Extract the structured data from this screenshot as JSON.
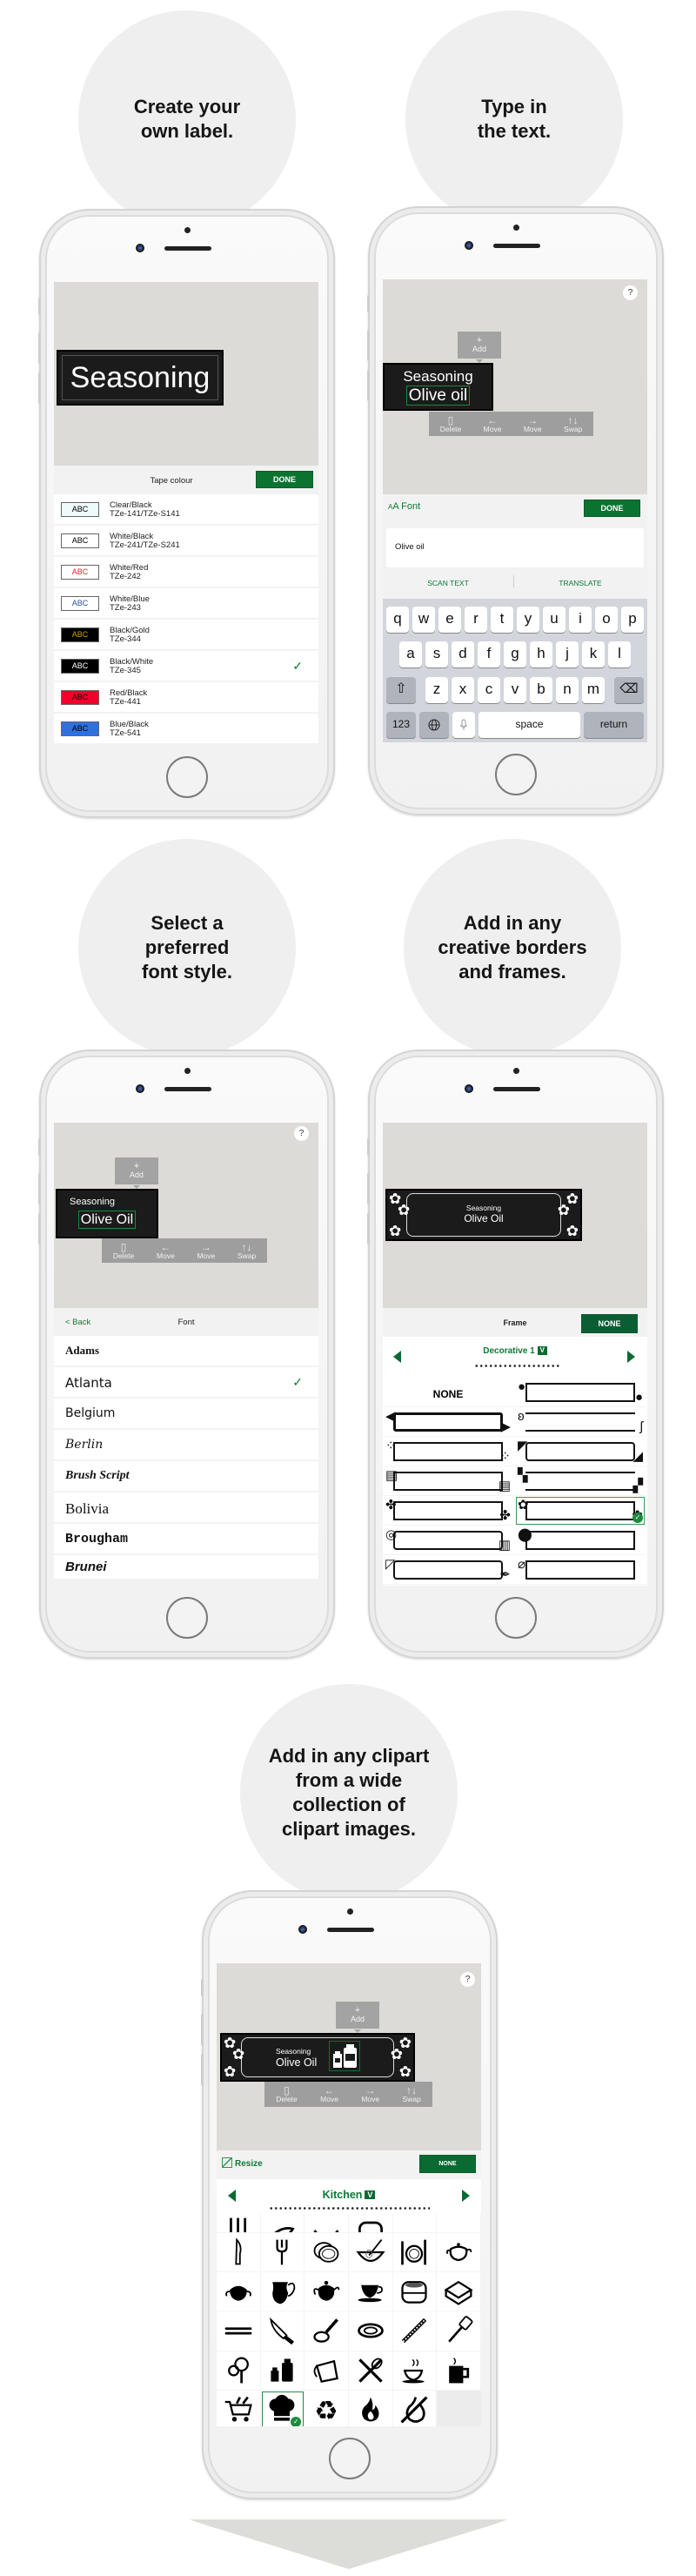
{
  "colors": {
    "accent": "#0b7a33",
    "button": "#0b7330",
    "canvas": "#dcdbd7",
    "circle": "#efefef",
    "arrow": "#dcdcd8"
  },
  "steps": [
    {
      "caption": [
        "Create your",
        "own label."
      ]
    },
    {
      "caption": [
        "Type in",
        "the text."
      ]
    },
    {
      "caption": [
        "Select a",
        "preferred",
        "font style."
      ]
    },
    {
      "caption": [
        "Add in any",
        "creative borders",
        "and frames."
      ]
    },
    {
      "caption": [
        "Add in any clipart",
        "from a wide",
        "collection of",
        "clipart images."
      ]
    }
  ],
  "phone1": {
    "label_text": "Seasoning",
    "toolbar_title": "Tape colour",
    "done": "DONE",
    "selected_index": 5,
    "tapes": [
      {
        "swatch": "ABC",
        "name": "Clear/Black",
        "code": "TZe-141/TZe-S141",
        "bg": "#eefafc",
        "fg": "#000000"
      },
      {
        "swatch": "ABC",
        "name": "White/Black",
        "code": "TZe-241/TZe-S241",
        "bg": "#ffffff",
        "fg": "#000000"
      },
      {
        "swatch": "ABC",
        "name": "White/Red",
        "code": "TZe-242",
        "bg": "#ffffff",
        "fg": "#e8232e"
      },
      {
        "swatch": "ABC",
        "name": "White/Blue",
        "code": "TZe-243",
        "bg": "#ffffff",
        "fg": "#2b4fa8"
      },
      {
        "swatch": "ABC",
        "name": "Black/Gold",
        "code": "TZe-344",
        "bg": "#000000",
        "fg": "#c9a000"
      },
      {
        "swatch": "ABC",
        "name": "Black/White",
        "code": "TZe-345",
        "bg": "#000000",
        "fg": "#ffffff"
      },
      {
        "swatch": "ABC",
        "name": "Red/Black",
        "code": "TZe-441",
        "bg": "#f0002a",
        "fg": "#000000"
      },
      {
        "swatch": "ABC",
        "name": "Blue/Black",
        "code": "TZe-541",
        "bg": "#2f6fe0",
        "fg": "#000000"
      }
    ]
  },
  "editor": {
    "help": "?",
    "add": "Add",
    "add_icon": "+",
    "actions": [
      {
        "label": "Delete",
        "icon": "trash-icon"
      },
      {
        "label": "Move",
        "icon": "arrow-left-icon"
      },
      {
        "label": "Move",
        "icon": "arrow-right-icon"
      },
      {
        "label": "Swap",
        "icon": "swap-icon"
      }
    ]
  },
  "phone2": {
    "label_line1": "Seasoning",
    "label_line2": "Olive oil",
    "font_icon_small": "A",
    "font_icon_large": "A",
    "font_button": "Font",
    "done": "DONE",
    "input_value": "Olive oil",
    "scan_text": "SCAN TEXT",
    "translate": "TRANSLATE",
    "keyboard": {
      "rows": [
        [
          "q",
          "w",
          "e",
          "r",
          "t",
          "y",
          "u",
          "i",
          "o",
          "p"
        ],
        [
          "a",
          "s",
          "d",
          "f",
          "g",
          "h",
          "j",
          "k",
          "l"
        ],
        [
          "z",
          "x",
          "c",
          "v",
          "b",
          "n",
          "m"
        ]
      ],
      "shift": "⇧",
      "backspace": "⌫",
      "numbers": "123",
      "space": "space",
      "return": "return"
    }
  },
  "phone3": {
    "label_line1": "Seasoning",
    "label_line2": "Olive Oil",
    "back": "< Back",
    "title": "Font",
    "selected_index": 1,
    "fonts": [
      "Adams",
      "Atlanta",
      "Belgium",
      "Berlin",
      "Brush Script",
      "Bolivia",
      "Brougham",
      "Brunei"
    ]
  },
  "phone4": {
    "label_line1": "Seasoning",
    "label_line2": "Olive Oil",
    "title": "Frame",
    "none_button": "NONE",
    "category": "Decorative 1",
    "category_toggle": "V",
    "none_option": "NONE",
    "selected_index": 9,
    "frames": [
      "none",
      "zigzag-dots",
      "hexagon",
      "swirl",
      "dot-grid",
      "corner-leaf",
      "striped-ends",
      "checker",
      "clover",
      "floral",
      "clip",
      "pin",
      "scroll",
      "paperclip"
    ]
  },
  "phone5": {
    "label_line1": "Seasoning",
    "label_line2": "Olive Oil",
    "resize": "Resize",
    "none_button": "NONE",
    "category": "Kitchen",
    "category_toggle": "V",
    "selected_index": 31,
    "cliparts": [
      "utensil-rack",
      "spoon",
      "bowl",
      "pot",
      "tray",
      "dish",
      "knife",
      "fork",
      "plates",
      "whisk-bowl",
      "place-setting",
      "teapot",
      "sugar-bowl",
      "pitcher",
      "teapot-filled",
      "teacup",
      "steamer",
      "box",
      "chopsticks",
      "chef-knife",
      "pan",
      "plate",
      "bread-knife",
      "spatula",
      "measuring-spoons",
      "bottles",
      "measuring-cup",
      "crossed-utensils",
      "coffee-cup",
      "mug",
      "cart",
      "chef-hat",
      "recycle",
      "fire",
      "no-fire"
    ]
  }
}
